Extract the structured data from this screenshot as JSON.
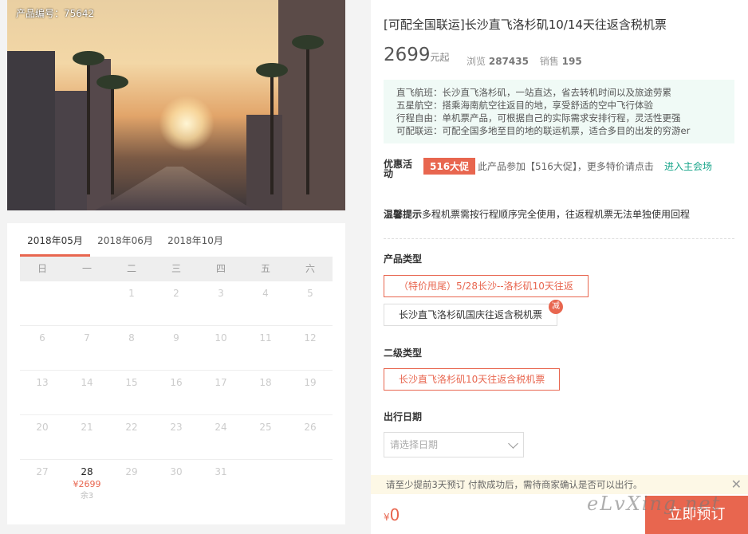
{
  "product": {
    "code_label": "产品编号：75642",
    "title": "[可配全国联运]长沙直飞洛杉矶10/14天往返含税机票",
    "price": "2699",
    "price_suffix": "元起",
    "views_label": "浏览",
    "views": "287435",
    "sales_label": "销售",
    "sales": "195"
  },
  "features": [
    "直飞航班：长沙直飞洛杉矶，一站直达，省去转机时间以及旅途劳累",
    "五星航空：搭乘海南航空往返目的地，享受舒适的空中飞行体验",
    "行程自由：单机票产品，可根据自己的实际需求安排行程，灵活性更强",
    "可配联运：可配全国多地至目的地的联运机票，适合多目的出发的穷游er"
  ],
  "promo": {
    "label": "优惠活动",
    "tag": "516大促",
    "text": "此产品参加【516大促】，更多特价请点击",
    "link": "进入主会场"
  },
  "tip": {
    "bold": "温馨提示",
    "text": "多程机票需按行程顺序完全使用，往返程机票无法单独使用回程"
  },
  "product_type": {
    "label": "产品类型",
    "options": [
      "（特价甩尾）5/28长沙--洛杉矶10天往返",
      "长沙直飞洛杉矶国庆往返含税机票"
    ],
    "badge": "减"
  },
  "sub_type": {
    "label": "二级类型",
    "options": [
      "长沙直飞洛杉矶10天往返含税机票"
    ]
  },
  "date": {
    "label": "出行日期",
    "placeholder": "请选择日期"
  },
  "notice": {
    "text": "请至少提前3天预订 付款成功后，需待商家确认是否可以出行。",
    "close": "✕"
  },
  "total": {
    "currency": "¥",
    "amount": "0"
  },
  "book_label": "立即预订",
  "watermark": "eLvXing.net",
  "calendar": {
    "tabs": [
      "2018年05月",
      "2018年06月",
      "2018年10月"
    ],
    "weekdays": [
      "日",
      "一",
      "二",
      "三",
      "四",
      "五",
      "六"
    ],
    "rows": [
      [
        "",
        "",
        "1",
        "2",
        "3",
        "4",
        "5"
      ],
      [
        "6",
        "7",
        "8",
        "9",
        "10",
        "11",
        "12"
      ],
      [
        "13",
        "14",
        "15",
        "16",
        "17",
        "18",
        "19"
      ],
      [
        "20",
        "21",
        "22",
        "23",
        "24",
        "25",
        "26"
      ],
      [
        "27",
        "28",
        "29",
        "30",
        "31",
        "",
        ""
      ]
    ],
    "available_day": {
      "day": "28",
      "price": "¥2699",
      "remain": "余3"
    }
  },
  "colors": {
    "accent": "#e8664f",
    "link": "#1aa68b",
    "feature_bg": "#f0faf6"
  }
}
